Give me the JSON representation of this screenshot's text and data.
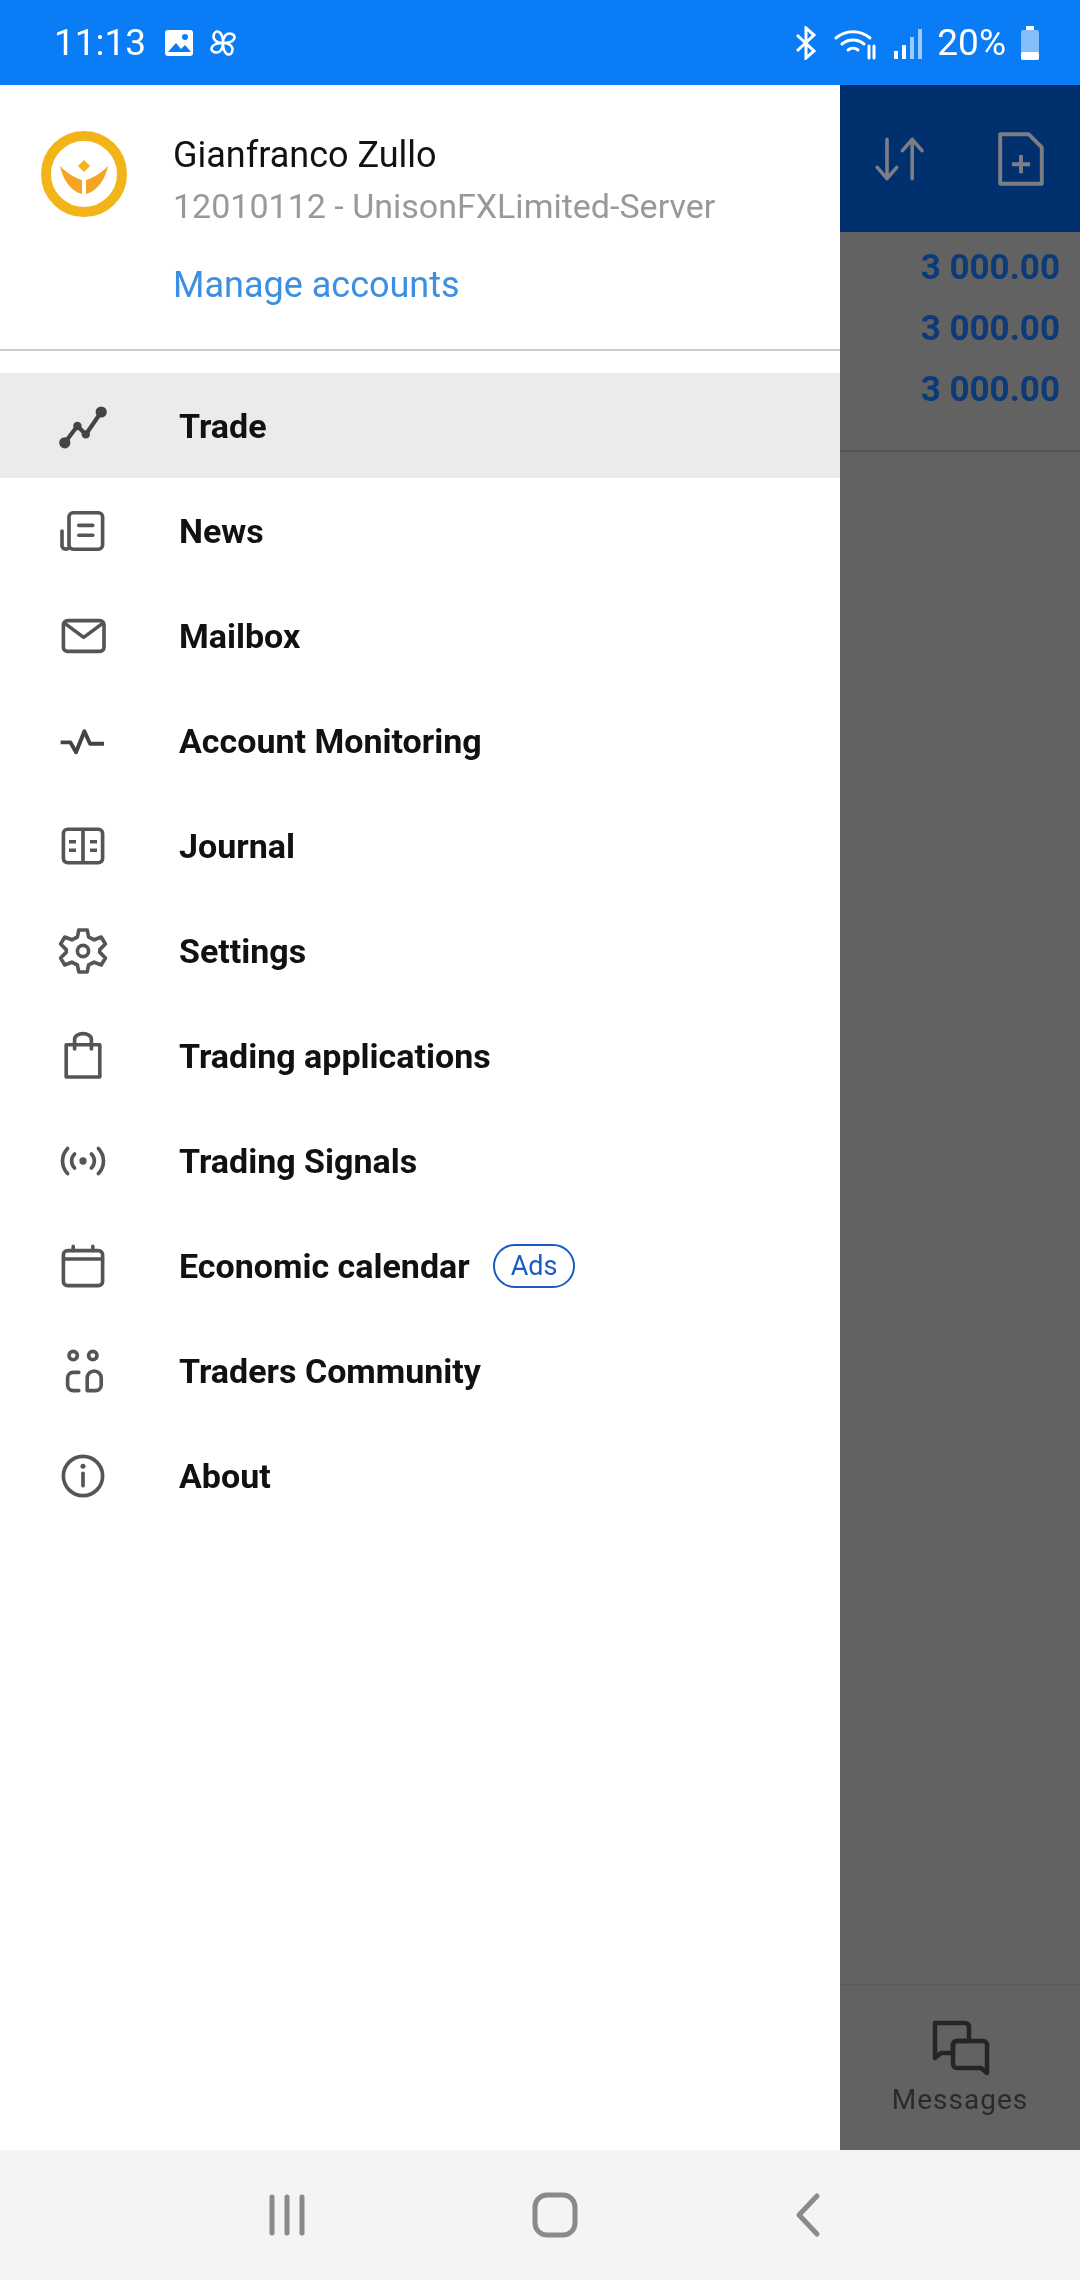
{
  "status_bar": {
    "time": "11:13",
    "battery": "20%"
  },
  "drawer": {
    "account": {
      "name": "Gianfranco Zullo",
      "server": "12010112 - UnisonFXLimited-Server",
      "manage_link": "Manage accounts"
    },
    "menu": [
      {
        "label": "Trade",
        "selected": true
      },
      {
        "label": "News",
        "selected": false
      },
      {
        "label": "Mailbox",
        "selected": false
      },
      {
        "label": "Account Monitoring",
        "selected": false
      },
      {
        "label": "Journal",
        "selected": false
      },
      {
        "label": "Settings",
        "selected": false
      },
      {
        "label": "Trading applications",
        "selected": false
      },
      {
        "label": "Trading Signals",
        "selected": false
      },
      {
        "label": "Economic calendar",
        "selected": false,
        "badge": "Ads"
      },
      {
        "label": "Traders Community",
        "selected": false
      },
      {
        "label": "About",
        "selected": false
      }
    ]
  },
  "background_screen": {
    "values": [
      "3 000.00",
      "3 000.00",
      "3 000.00"
    ],
    "bottom_tab": "Messages"
  }
}
